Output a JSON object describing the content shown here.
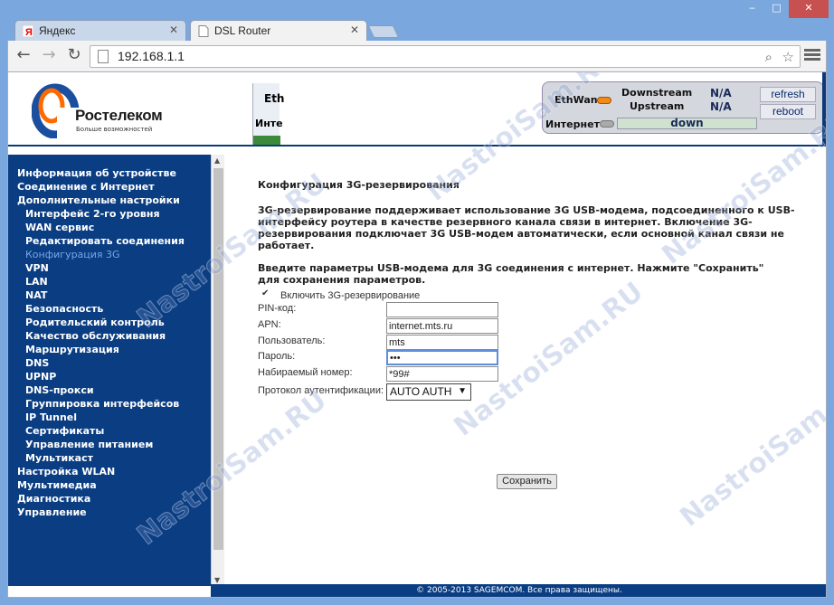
{
  "browser": {
    "tabs": [
      {
        "label": "Яндекс"
      },
      {
        "label": "DSL Router"
      }
    ],
    "url": "192.168.1.1",
    "caption": {
      "minimize": "‒",
      "maximize": "□",
      "close": "✕"
    }
  },
  "header": {
    "brand": "Ростелеком",
    "brand_sub": "Больше возможностей",
    "nav_top": "Eth",
    "nav_bottom": "Инте",
    "status": {
      "ethwan_label": "EthWan",
      "downstream_label": "Downstream",
      "downstream_value": "N/A",
      "upstream_label": "Upstream",
      "upstream_value": "N/A",
      "internet_label": "Интернет",
      "internet_value": "down",
      "refresh_label": "refresh",
      "reboot_label": "reboot"
    },
    "colors": {
      "brand_blue": "#0a3d82",
      "led_orange": "#f28a1a"
    }
  },
  "sidebar": {
    "items": [
      {
        "label": "Информация об устройстве",
        "level": 1
      },
      {
        "label": "Соединение с Интернет",
        "level": 1
      },
      {
        "label": "Дополнительные настройки",
        "level": 1
      },
      {
        "label": "Интерфейс 2-го уровня",
        "level": 2
      },
      {
        "label": "WAN сервис",
        "level": 2
      },
      {
        "label": "Редактировать соединения",
        "level": 2
      },
      {
        "label": "Конфигурация 3G",
        "level": 2,
        "active": true
      },
      {
        "label": "VPN",
        "level": 2
      },
      {
        "label": "LAN",
        "level": 2
      },
      {
        "label": "NAT",
        "level": 2
      },
      {
        "label": "Безопасность",
        "level": 2
      },
      {
        "label": "Родительский контроль",
        "level": 2
      },
      {
        "label": "Качество обслуживания",
        "level": 2
      },
      {
        "label": "Маршрутизация",
        "level": 2
      },
      {
        "label": "DNS",
        "level": 2
      },
      {
        "label": "UPNP",
        "level": 2
      },
      {
        "label": "DNS-прокси",
        "level": 2
      },
      {
        "label": "Группировка интерфейсов",
        "level": 2
      },
      {
        "label": "IP Tunnel",
        "level": 2
      },
      {
        "label": "Сертификаты",
        "level": 2
      },
      {
        "label": "Управление питанием",
        "level": 2
      },
      {
        "label": "Мультикаст",
        "level": 2
      },
      {
        "label": "Настройка WLAN",
        "level": 1
      },
      {
        "label": "Мультимедиа",
        "level": 1
      },
      {
        "label": "Диагностика",
        "level": 1
      },
      {
        "label": "Управление",
        "level": 1
      }
    ]
  },
  "main": {
    "title": "Конфигурация 3G-резервирования",
    "desc1": "3G-резервирование поддерживает использование 3G USB-модема, подсоединенного к USB-интерфейсу роутера в качестве резервного канала связи в интернет. Включение 3G-резервирования подключает 3G USB-модем автоматически, если основной канал связи не работает.",
    "desc2": "Введите параметры USB-модема для 3G соединения с интернет. Нажмите \"Сохранить\" для сохранения параметров.",
    "form": {
      "enable_label": "Включить 3G-резервирование",
      "enable_checked": true,
      "pin_label": "PIN-код:",
      "pin_value": "",
      "apn_label": "APN:",
      "apn_value": "internet.mts.ru",
      "user_label": "Пользователь:",
      "user_value": "mts",
      "password_label": "Пароль:",
      "password_value": "•••",
      "dial_label": "Набираемый номер:",
      "dial_value": "*99#",
      "auth_label": "Протокол аутентификации:",
      "auth_value": "AUTO AUTH",
      "save_label": "Сохранить"
    }
  },
  "footer": {
    "text": "© 2005-2013 SAGEMCOM. Все права защищены."
  },
  "watermark": "NastroiSam.RU"
}
